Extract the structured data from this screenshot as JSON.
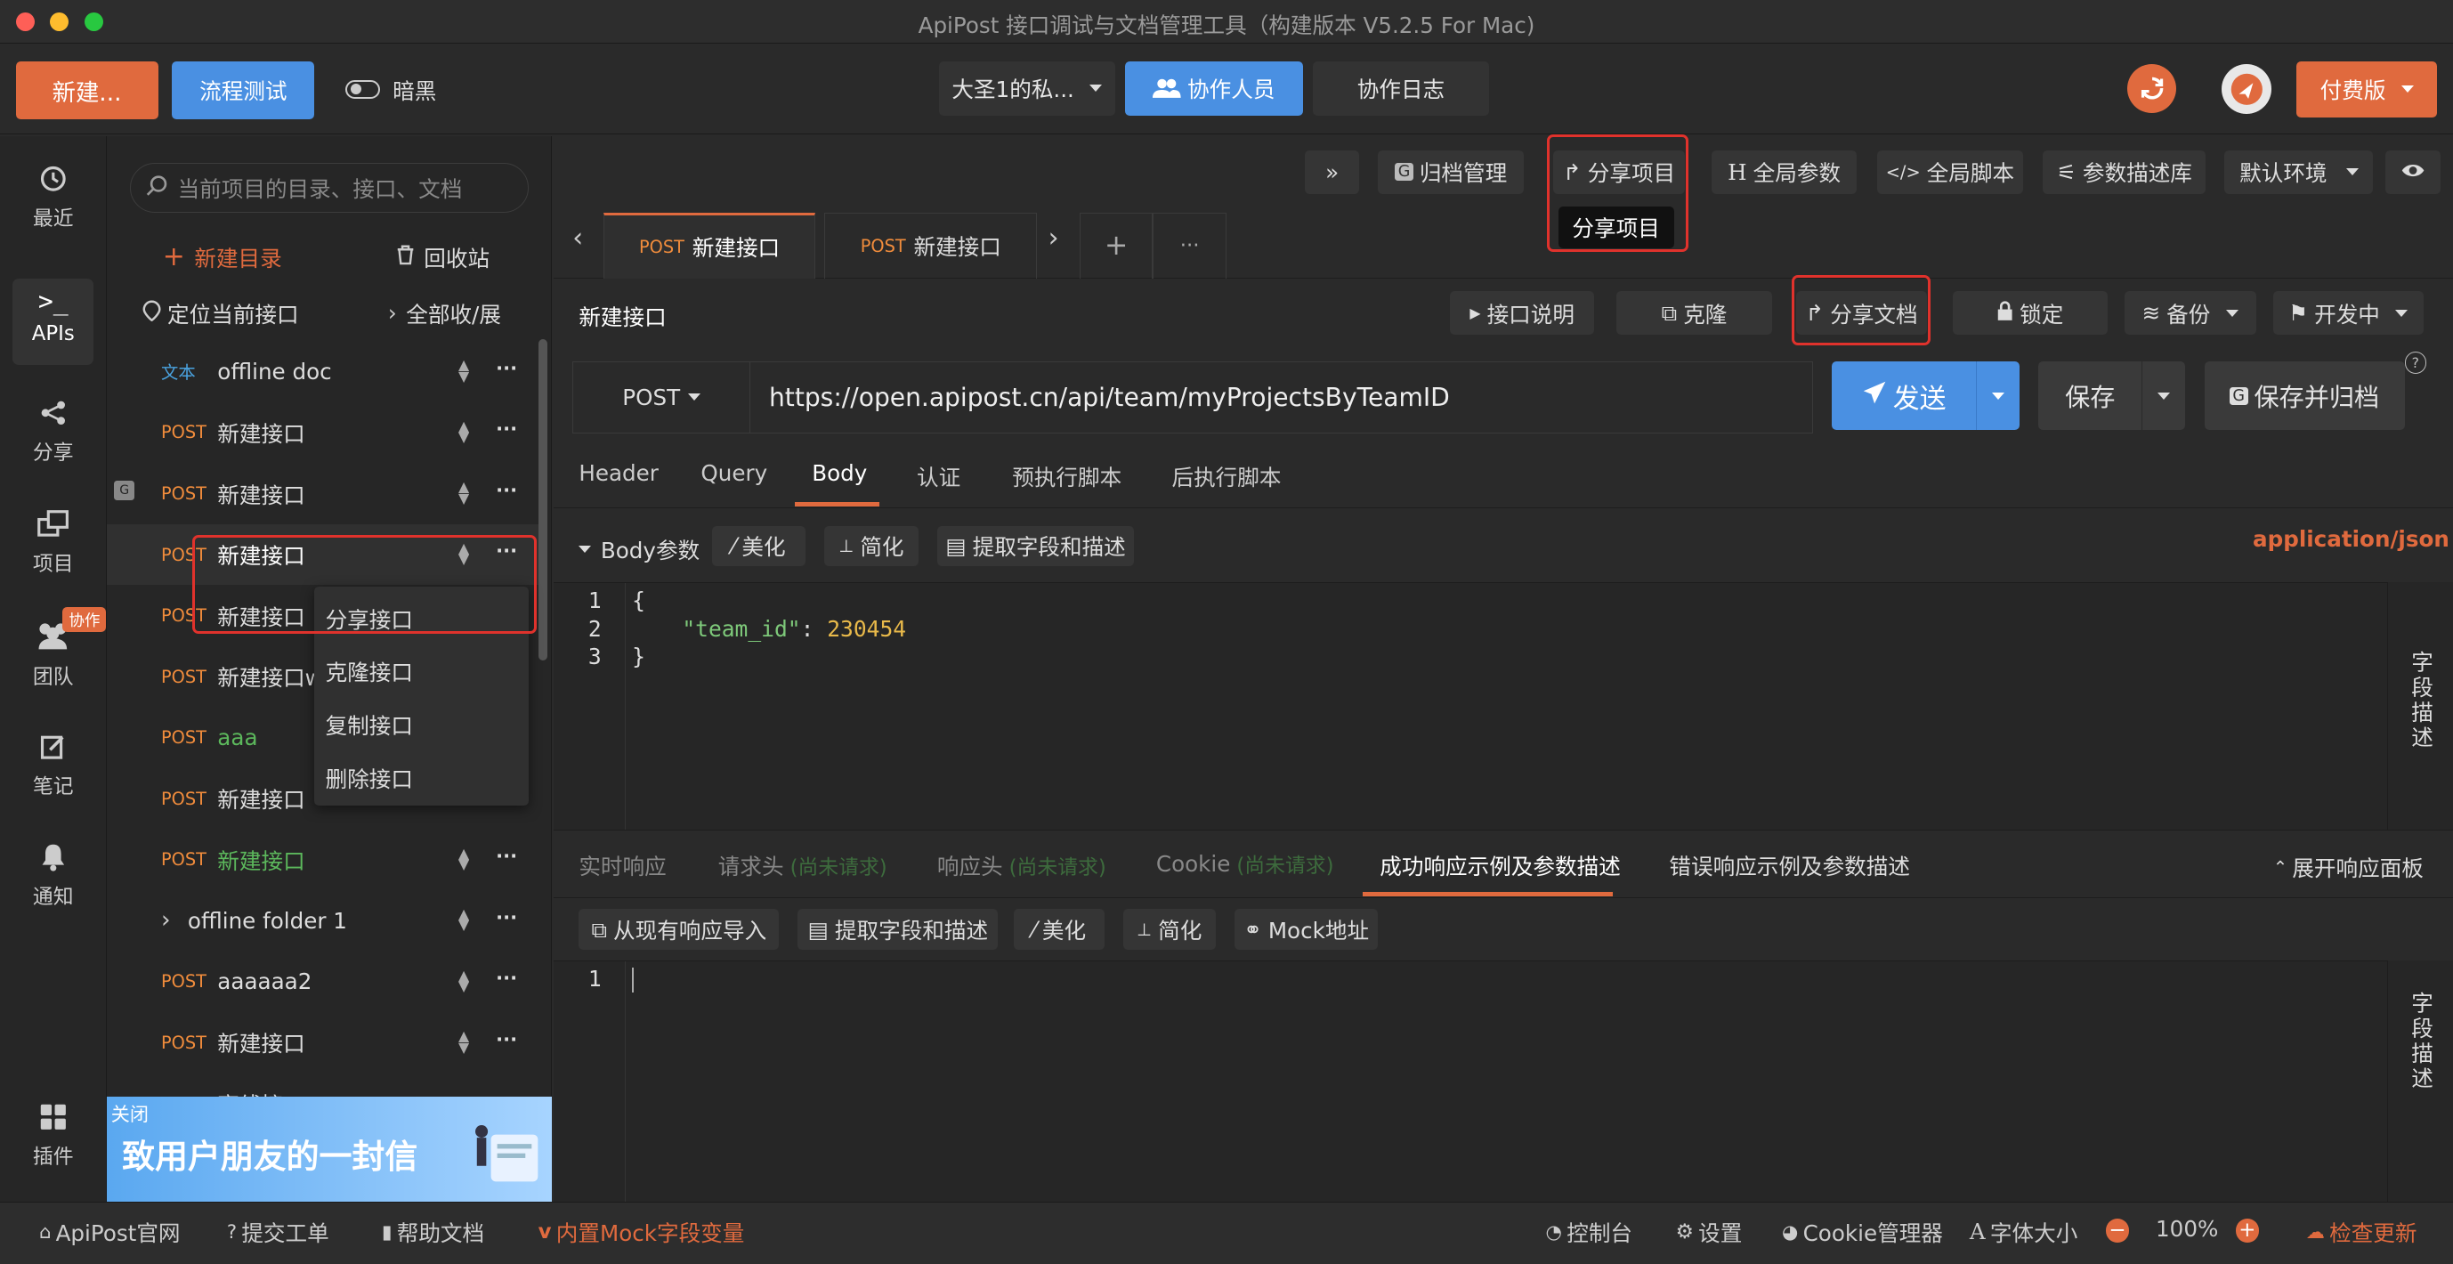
{
  "window": {
    "title": "ApiPost 接口调试与文档管理工具（构建版本 V5.2.5 For Mac)"
  },
  "colors": {
    "accent": "#e06a3e",
    "blue": "#4a90e2",
    "bg": "#2a2a2a",
    "panel": "#232323",
    "red": "#e0322c",
    "green": "#5cb85c"
  },
  "topbar": {
    "new_label": "新建...",
    "flow_label": "流程测试",
    "dark_label": "暗黑",
    "team_select": "大圣1的私...",
    "collab_label": "协作人员",
    "log_label": "协作日志",
    "paid_label": "付费版"
  },
  "sidebar": {
    "items": [
      {
        "label": "最近",
        "icon": "clock-icon"
      },
      {
        "label": "APIs",
        "icon": "terminal-icon"
      },
      {
        "label": "分享",
        "icon": "share-icon"
      },
      {
        "label": "项目",
        "icon": "project-icon"
      },
      {
        "label": "团队",
        "icon": "team-icon",
        "badge": "协作"
      },
      {
        "label": "笔记",
        "icon": "note-icon"
      },
      {
        "label": "通知",
        "icon": "bell-icon"
      }
    ],
    "plugin_label": "插件"
  },
  "tree": {
    "search_placeholder": "当前项目的目录、接口、文档",
    "new_dir": "新建目录",
    "recycle": "回收站",
    "locate": "定位当前接口",
    "toggle_all": "全部收/展",
    "rows": [
      {
        "method": "文本",
        "name": "offline doc"
      },
      {
        "method": "POST",
        "name": "新建接口"
      },
      {
        "method": "POST",
        "name": "新建接口"
      },
      {
        "method": "POST",
        "name": "新建接口"
      },
      {
        "method": "POST",
        "name": "新建接口"
      },
      {
        "method": "POST",
        "name": "新建接口w"
      },
      {
        "method": "POST",
        "name": "aaa"
      },
      {
        "method": "POST",
        "name": "新建接口"
      },
      {
        "method": "POST",
        "name": "新建接口"
      },
      {
        "method": "",
        "name": "offline folder 1"
      },
      {
        "method": "POST",
        "name": "aaaaaa2"
      },
      {
        "method": "POST",
        "name": "新建接口"
      },
      {
        "method": "POST",
        "name": "离线接口"
      }
    ],
    "context_menu": [
      "分享接口",
      "克隆接口",
      "复制接口",
      "删除接口"
    ]
  },
  "banner": {
    "close": "关闭",
    "text": "致用户朋友的一封信"
  },
  "toolbar2": {
    "expand": "»",
    "archive": "归档管理",
    "share_project": "分享项目",
    "global_params": "全局参数",
    "global_script": "全局脚本",
    "param_lib": "参数描述库",
    "env": "默认环境",
    "tooltip": "分享项目"
  },
  "tabs": [
    {
      "method": "POST",
      "name": "新建接口"
    },
    {
      "method": "POST",
      "name": "新建接口"
    }
  ],
  "tab_extra": {
    "plus": "+",
    "more": "···"
  },
  "api": {
    "title": "新建接口",
    "desc_btn": "接口说明",
    "clone_btn": "克隆",
    "share_doc_btn": "分享文档",
    "lock_btn": "锁定",
    "backup_btn": "备份",
    "status_btn": "开发中",
    "method": "POST",
    "url": "https://open.apipost.cn/api/team/myProjectsByTeamID",
    "send": "发送",
    "save": "保存",
    "save_archive": "保存并归档",
    "help": "?"
  },
  "req_tabs": [
    "Header",
    "Query",
    "Body",
    "认证",
    "预执行脚本",
    "后执行脚本"
  ],
  "body": {
    "label": "Body参数",
    "beautify": "美化",
    "simplify": "简化",
    "extract": "提取字段和描述",
    "content_type": "application/json",
    "lines": [
      {
        "n": "1",
        "text": "{"
      },
      {
        "n": "2",
        "key": "\"team_id\"",
        "sep": ": ",
        "val": "230454"
      },
      {
        "n": "3",
        "text": "}"
      }
    ],
    "field_desc": "字段描述"
  },
  "resp": {
    "tabs": [
      {
        "label": "实时响应"
      },
      {
        "label": "请求头",
        "note": "(尚未请求)"
      },
      {
        "label": "响应头",
        "note": "(尚未请求)"
      },
      {
        "label": "Cookie",
        "note": "(尚未请求)"
      },
      {
        "label": "成功响应示例及参数描述"
      },
      {
        "label": "错误响应示例及参数描述"
      }
    ],
    "expand": "展开响应面板",
    "import": "从现有响应导入",
    "extract": "提取字段和描述",
    "beautify": "美化",
    "simplify": "简化",
    "mock": "Mock地址",
    "line1": "1",
    "field_desc": "字段描述"
  },
  "statusbar": {
    "site": "ApiPost官网",
    "ticket": "提交工单",
    "help": "帮助文档",
    "mock": "内置Mock字段变量",
    "console": "控制台",
    "settings": "设置",
    "cookie": "Cookie管理器",
    "font": "字体大小",
    "zoom": "100%",
    "update": "检查更新"
  }
}
